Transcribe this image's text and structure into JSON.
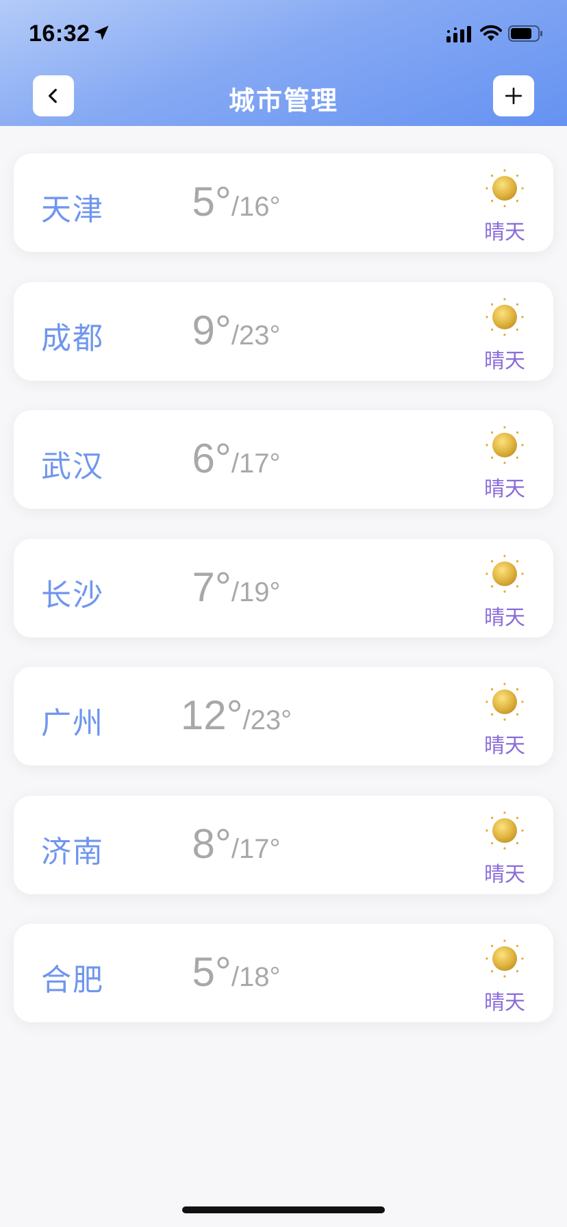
{
  "status_bar": {
    "time": "16:32",
    "icons": [
      "location-arrow-icon",
      "cellular-signal-icon",
      "wifi-icon",
      "battery-icon"
    ]
  },
  "nav": {
    "title": "城市管理",
    "back_icon": "chevron-left-icon",
    "add_icon": "plus-icon"
  },
  "colors": {
    "header_gradient": [
      "#b3cbf8",
      "#6592f2"
    ],
    "city_name": "#6f96ee",
    "temperature": "#a8a8a8",
    "weather_text": "#8a6bd8",
    "sun": "#e3b84a"
  },
  "cities": [
    {
      "name": "天津",
      "low": "5°",
      "high": "/16°",
      "weather": "晴天",
      "icon": "sun-icon"
    },
    {
      "name": "成都",
      "low": "9°",
      "high": "/23°",
      "weather": "晴天",
      "icon": "sun-icon"
    },
    {
      "name": "武汉",
      "low": "6°",
      "high": "/17°",
      "weather": "晴天",
      "icon": "sun-icon"
    },
    {
      "name": "长沙",
      "low": "7°",
      "high": "/19°",
      "weather": "晴天",
      "icon": "sun-icon"
    },
    {
      "name": "广州",
      "low": "12°",
      "high": "/23°",
      "weather": "晴天",
      "icon": "sun-icon"
    },
    {
      "name": "济南",
      "low": "8°",
      "high": "/17°",
      "weather": "晴天",
      "icon": "sun-icon"
    },
    {
      "name": "合肥",
      "low": "5°",
      "high": "/18°",
      "weather": "晴天",
      "icon": "sun-icon"
    }
  ]
}
